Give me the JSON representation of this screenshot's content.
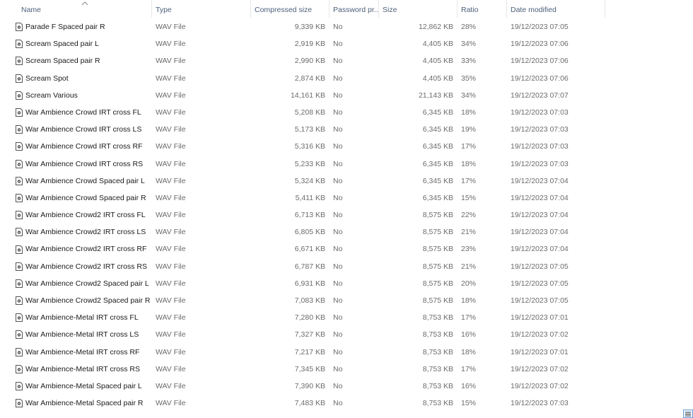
{
  "columns": {
    "name": "Name",
    "type": "Type",
    "compressed": "Compressed size",
    "password": "Password pr...",
    "size": "Size",
    "ratio": "Ratio",
    "date": "Date modified"
  },
  "rows": [
    {
      "name": "Parade F Spaced pair R",
      "type": "WAV File",
      "compressed": "9,339 KB",
      "password": "No",
      "size": "12,862 KB",
      "ratio": "28%",
      "date": "19/12/2023 07:05"
    },
    {
      "name": "Scream Spaced pair L",
      "type": "WAV File",
      "compressed": "2,919 KB",
      "password": "No",
      "size": "4,405 KB",
      "ratio": "34%",
      "date": "19/12/2023 07:06"
    },
    {
      "name": "Scream Spaced pair R",
      "type": "WAV File",
      "compressed": "2,990 KB",
      "password": "No",
      "size": "4,405 KB",
      "ratio": "33%",
      "date": "19/12/2023 07:06"
    },
    {
      "name": "Scream Spot",
      "type": "WAV File",
      "compressed": "2,874 KB",
      "password": "No",
      "size": "4,405 KB",
      "ratio": "35%",
      "date": "19/12/2023 07:06"
    },
    {
      "name": "Scream Various",
      "type": "WAV File",
      "compressed": "14,161 KB",
      "password": "No",
      "size": "21,143 KB",
      "ratio": "34%",
      "date": "19/12/2023 07:07"
    },
    {
      "name": "War Ambience Crowd IRT cross FL",
      "type": "WAV File",
      "compressed": "5,208 KB",
      "password": "No",
      "size": "6,345 KB",
      "ratio": "18%",
      "date": "19/12/2023 07:03"
    },
    {
      "name": "War Ambience Crowd IRT cross LS",
      "type": "WAV File",
      "compressed": "5,173 KB",
      "password": "No",
      "size": "6,345 KB",
      "ratio": "19%",
      "date": "19/12/2023 07:03"
    },
    {
      "name": "War Ambience Crowd IRT cross RF",
      "type": "WAV File",
      "compressed": "5,316 KB",
      "password": "No",
      "size": "6,345 KB",
      "ratio": "17%",
      "date": "19/12/2023 07:03"
    },
    {
      "name": "War Ambience Crowd IRT cross RS",
      "type": "WAV File",
      "compressed": "5,233 KB",
      "password": "No",
      "size": "6,345 KB",
      "ratio": "18%",
      "date": "19/12/2023 07:03"
    },
    {
      "name": "War Ambience Crowd Spaced pair L",
      "type": "WAV File",
      "compressed": "5,324 KB",
      "password": "No",
      "size": "6,345 KB",
      "ratio": "17%",
      "date": "19/12/2023 07:04"
    },
    {
      "name": "War Ambience Crowd Spaced pair R",
      "type": "WAV File",
      "compressed": "5,411 KB",
      "password": "No",
      "size": "6,345 KB",
      "ratio": "15%",
      "date": "19/12/2023 07:04"
    },
    {
      "name": "War Ambience Crowd2 IRT cross FL",
      "type": "WAV File",
      "compressed": "6,713 KB",
      "password": "No",
      "size": "8,575 KB",
      "ratio": "22%",
      "date": "19/12/2023 07:04"
    },
    {
      "name": "War Ambience Crowd2 IRT cross LS",
      "type": "WAV File",
      "compressed": "6,805 KB",
      "password": "No",
      "size": "8,575 KB",
      "ratio": "21%",
      "date": "19/12/2023 07:04"
    },
    {
      "name": "War Ambience Crowd2 IRT cross RF",
      "type": "WAV File",
      "compressed": "6,671 KB",
      "password": "No",
      "size": "8,575 KB",
      "ratio": "23%",
      "date": "19/12/2023 07:04"
    },
    {
      "name": "War Ambience Crowd2 IRT cross RS",
      "type": "WAV File",
      "compressed": "6,787 KB",
      "password": "No",
      "size": "8,575 KB",
      "ratio": "21%",
      "date": "19/12/2023 07:05"
    },
    {
      "name": "War Ambience Crowd2 Spaced pair L",
      "type": "WAV File",
      "compressed": "6,931 KB",
      "password": "No",
      "size": "8,575 KB",
      "ratio": "20%",
      "date": "19/12/2023 07:05"
    },
    {
      "name": "War Ambience Crowd2 Spaced pair R",
      "type": "WAV File",
      "compressed": "7,083 KB",
      "password": "No",
      "size": "8,575 KB",
      "ratio": "18%",
      "date": "19/12/2023 07:05"
    },
    {
      "name": "War Ambience-Metal IRT cross FL",
      "type": "WAV File",
      "compressed": "7,280 KB",
      "password": "No",
      "size": "8,753 KB",
      "ratio": "17%",
      "date": "19/12/2023 07:01"
    },
    {
      "name": "War Ambience-Metal IRT cross LS",
      "type": "WAV File",
      "compressed": "7,327 KB",
      "password": "No",
      "size": "8,753 KB",
      "ratio": "16%",
      "date": "19/12/2023 07:02"
    },
    {
      "name": "War Ambience-Metal IRT cross RF",
      "type": "WAV File",
      "compressed": "7,217 KB",
      "password": "No",
      "size": "8,753 KB",
      "ratio": "18%",
      "date": "19/12/2023 07:01"
    },
    {
      "name": "War Ambience-Metal IRT cross RS",
      "type": "WAV File",
      "compressed": "7,345 KB",
      "password": "No",
      "size": "8,753 KB",
      "ratio": "17%",
      "date": "19/12/2023 07:02"
    },
    {
      "name": "War Ambience-Metal Spaced pair L",
      "type": "WAV File",
      "compressed": "7,390 KB",
      "password": "No",
      "size": "8,753 KB",
      "ratio": "16%",
      "date": "19/12/2023 07:02"
    },
    {
      "name": "War Ambience-Metal Spaced pair R",
      "type": "WAV File",
      "compressed": "7,483 KB",
      "password": "No",
      "size": "8,753 KB",
      "ratio": "15%",
      "date": "19/12/2023 07:03"
    }
  ],
  "icons": {
    "file": "wav-file-icon",
    "sort": "sort-up-caret-icon",
    "corner": "details-view-icon"
  },
  "colors": {
    "header_text": "#4c607a",
    "column_divider": "#e6e6e6",
    "secondary_text": "#6b6b6b"
  }
}
